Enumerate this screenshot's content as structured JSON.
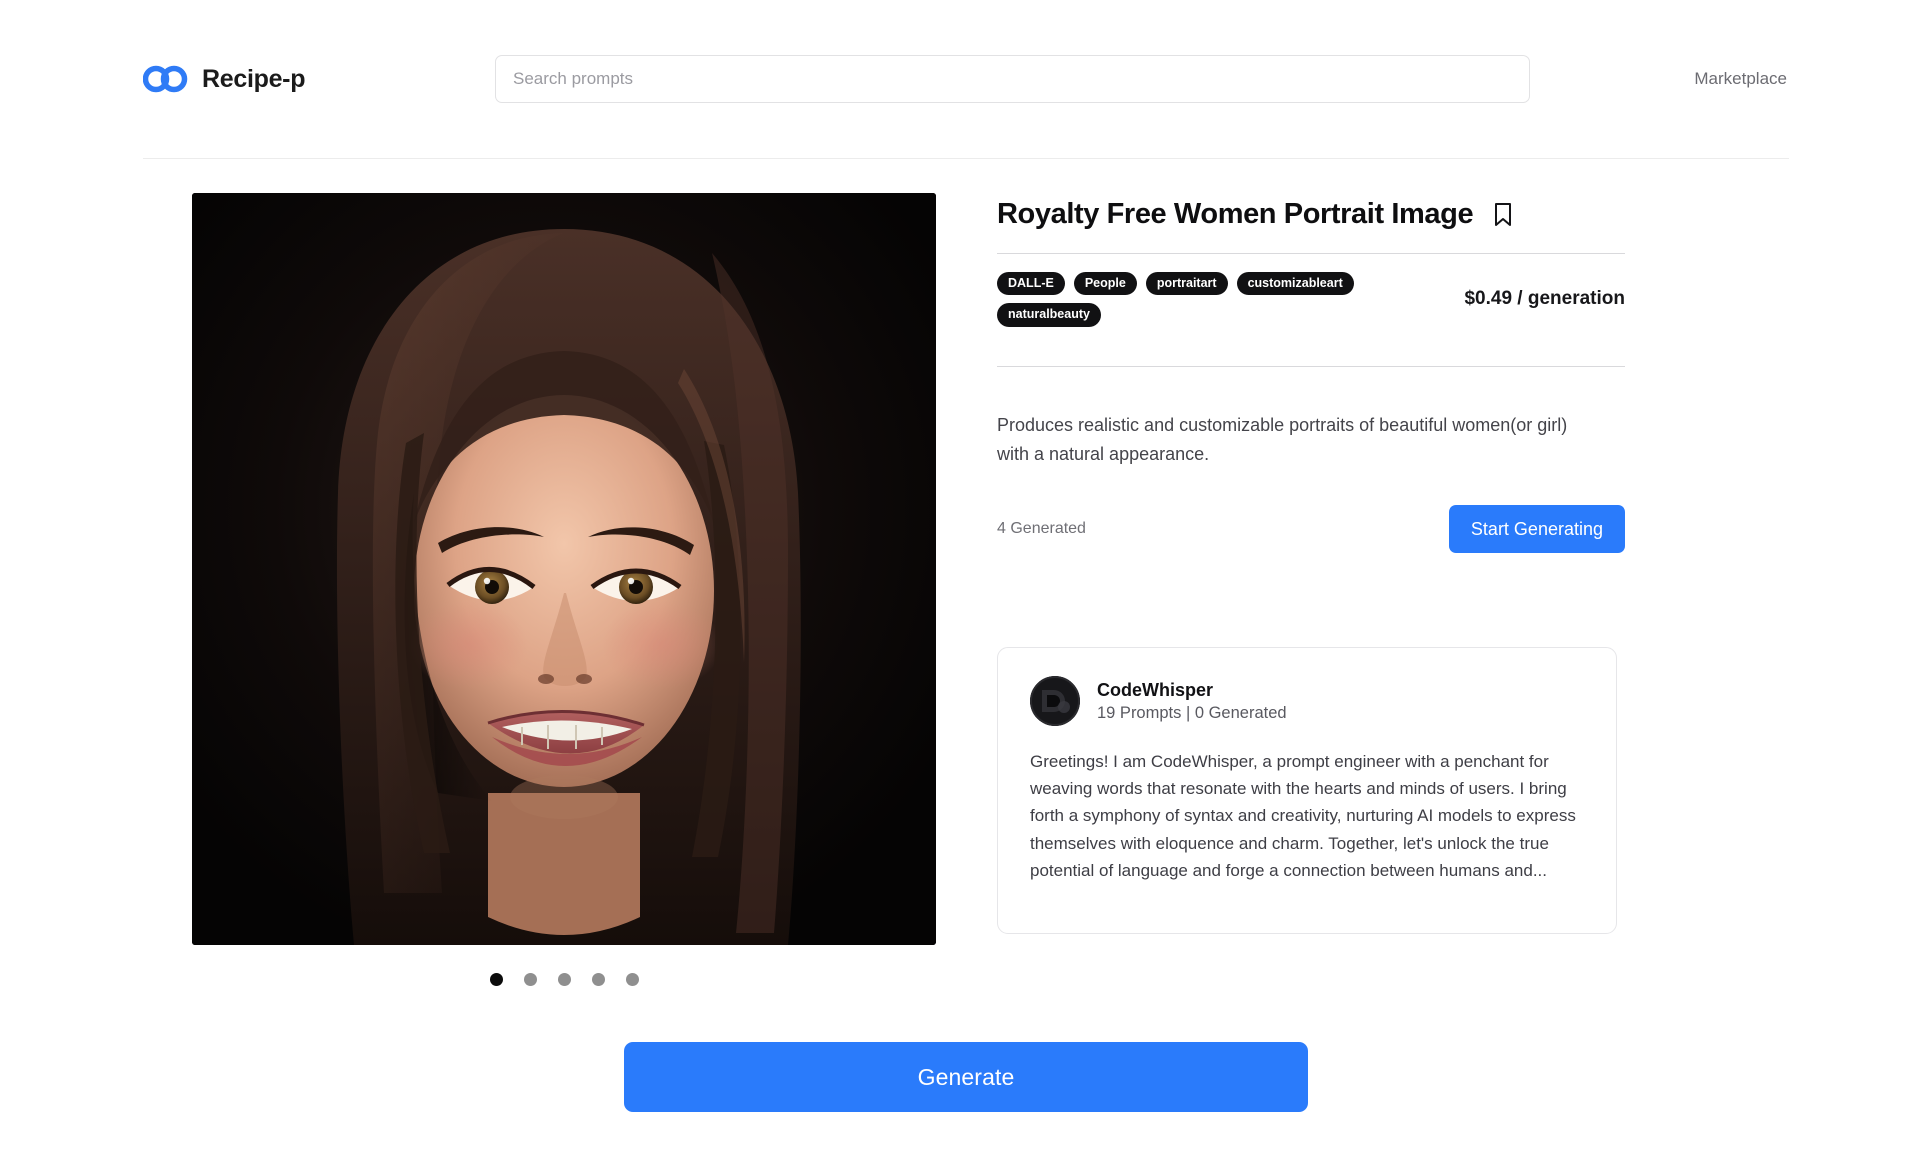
{
  "header": {
    "brand_name": "Recipe-p",
    "logo_icon": "double-circle-logo-icon",
    "search_placeholder": "Search prompts",
    "search_value": "",
    "nav_marketplace": "Marketplace"
  },
  "carousel": {
    "slide_count": 5,
    "active_index": 0,
    "image_alt": "Portrait of a smiling young girl with long dark hair on a black background"
  },
  "detail": {
    "title": "Royalty Free Women Portrait Image",
    "bookmark_icon": "bookmark-icon",
    "tags": [
      "DALL-E",
      "People",
      "portraitart",
      "customizableart",
      "naturalbeauty"
    ],
    "price": "$0.49 / generation",
    "description": "Produces realistic and customizable portraits of beautiful women(or girl) with a natural appearance.",
    "generated_count": "4 Generated",
    "start_generating_label": "Start Generating"
  },
  "author": {
    "avatar_icon": "user-avatar",
    "name": "CodeWhisper",
    "stats": "19 Prompts | 0 Generated",
    "bio": "Greetings! I am CodeWhisper, a prompt engineer with a penchant for weaving words that resonate with the hearts and minds of users. I bring forth a symphony of syntax and creativity, nurturing AI models to express themselves with eloquence and charm. Together, let's unlock the true potential of language and forge a connection between humans and..."
  },
  "footer": {
    "generate_label": "Generate"
  },
  "colors": {
    "accent_blue": "#2a7bfb",
    "logo_blue": "#2f7bf6",
    "tag_bg": "#111113",
    "text_primary": "#0e0e10",
    "text_muted": "#6c6c72",
    "border": "#e6e6e9"
  }
}
